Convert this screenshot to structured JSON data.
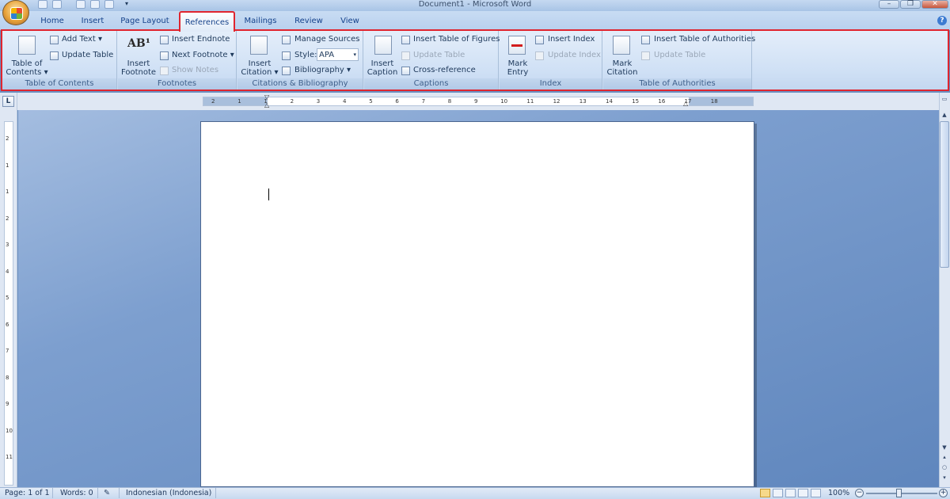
{
  "window": {
    "title": "Document1 - Microsoft Word"
  },
  "window_controls": {
    "minimize": "–",
    "restore": "❐",
    "close": "✕"
  },
  "tabs": [
    "Home",
    "Insert",
    "Page Layout",
    "References",
    "Mailings",
    "Review",
    "View"
  ],
  "active_tab": "References",
  "help_symbol": "?",
  "ribbon": {
    "toc": {
      "big_line1": "Table of",
      "big_line2": "Contents ▾",
      "add_text": "Add Text ▾",
      "update_table": "Update Table",
      "label": "Table of Contents"
    },
    "footnotes": {
      "big_line1": "Insert",
      "big_line2": "Footnote",
      "icon_text": "AB¹",
      "insert_endnote": "Insert Endnote",
      "next_footnote": "Next Footnote ▾",
      "show_notes": "Show Notes",
      "label": "Footnotes"
    },
    "citations": {
      "big_line1": "Insert",
      "big_line2": "Citation ▾",
      "manage_sources": "Manage Sources",
      "style_label": "Style:",
      "style_value": "APA",
      "bibliography": "Bibliography ▾",
      "label": "Citations & Bibliography"
    },
    "captions": {
      "big_line1": "Insert",
      "big_line2": "Caption",
      "insert_tof": "Insert Table of Figures",
      "update_table": "Update Table",
      "cross_reference": "Cross-reference",
      "label": "Captions"
    },
    "index": {
      "big_line1": "Mark",
      "big_line2": "Entry",
      "insert_index": "Insert Index",
      "update_index": "Update Index",
      "label": "Index"
    },
    "toa": {
      "big_line1": "Mark",
      "big_line2": "Citation",
      "insert_toa": "Insert Table of Authorities",
      "update_table": "Update Table",
      "label": "Table of Authorities"
    }
  },
  "ruler_tab_selector": "L",
  "hruler_ticks": [
    "2",
    "1",
    "1",
    "2",
    "3",
    "4",
    "5",
    "6",
    "7",
    "8",
    "9",
    "10",
    "11",
    "12",
    "13",
    "14",
    "15",
    "16",
    "17",
    "18"
  ],
  "vruler_ticks": [
    "2",
    "1",
    "1",
    "2",
    "3",
    "4",
    "5",
    "6",
    "7",
    "8",
    "9",
    "10",
    "11"
  ],
  "status": {
    "page": "Page: 1 of 1",
    "words": "Words: 0",
    "language": "Indonesian (Indonesia)",
    "zoom": "100%"
  }
}
